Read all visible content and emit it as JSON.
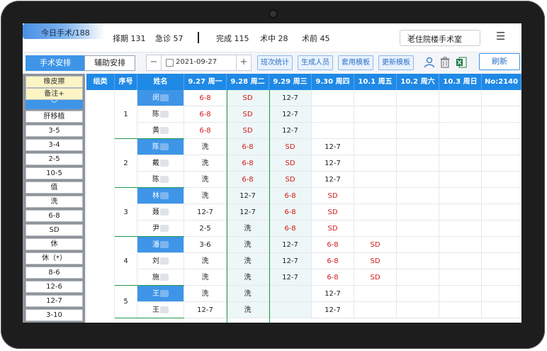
{
  "topbar": {
    "today_label": "今日手术/188",
    "stats": [
      {
        "label": "择期 131"
      },
      {
        "label": "急诊 57"
      },
      {
        "label": "完成 115"
      },
      {
        "label": "术中 28"
      },
      {
        "label": "术前 45"
      }
    ],
    "room_select": "老住院楼手术室",
    "menu_icon": "hamburger-menu-icon"
  },
  "toolbar": {
    "tab_active": "手术安排",
    "tab_inactive": "辅助安排",
    "date_value": "2021-09-27",
    "minus_label": "−",
    "plus_label": "+",
    "buttons": [
      "班次统计",
      "生成人员",
      "套用模板",
      "更新模板"
    ],
    "refresh_label": "刷新",
    "icons": [
      "user-icon",
      "trash-icon",
      "excel-icon"
    ]
  },
  "sidebar": {
    "items": [
      "橡皮擦",
      "备注+",
      "﹀",
      "肝移植",
      "3-5",
      "3-4",
      "2-5",
      "10-5",
      "值",
      "洗",
      "6-8",
      "SD",
      "休",
      "休（*）",
      "8-6",
      "12-6",
      "12-7",
      "3-10"
    ]
  },
  "grid": {
    "headers": [
      "组类",
      "序号",
      "姓名",
      "9.27 周一",
      "9.28 周二",
      "9.29 周三",
      "9.30 周四",
      "10.1 周五",
      "10.2 周六",
      "10.3 周日",
      "No:2140"
    ],
    "groups": [
      {
        "no": "1",
        "rows": [
          {
            "name": "闵",
            "hl": true,
            "days": [
              "6-8",
              "SD",
              "12-7",
              "",
              "",
              "",
              ""
            ]
          },
          {
            "name": "陈",
            "hl": false,
            "days": [
              "6-8",
              "SD",
              "12-7",
              "",
              "",
              "",
              ""
            ]
          },
          {
            "name": "黄",
            "hl": false,
            "days": [
              "6-8",
              "SD",
              "12-7",
              "",
              "",
              "",
              ""
            ]
          }
        ]
      },
      {
        "no": "2",
        "rows": [
          {
            "name": "陈",
            "hl": true,
            "days": [
              "洗",
              "6-8",
              "SD",
              "12-7",
              "",
              "",
              ""
            ]
          },
          {
            "name": "戴",
            "hl": false,
            "days": [
              "洗",
              "6-8",
              "SD",
              "12-7",
              "",
              "",
              ""
            ]
          },
          {
            "name": "陈",
            "hl": false,
            "days": [
              "洗",
              "6-8",
              "SD",
              "12-7",
              "",
              "",
              ""
            ]
          }
        ]
      },
      {
        "no": "3",
        "rows": [
          {
            "name": "林",
            "hl": true,
            "days": [
              "洗",
              "12-7",
              "6-8",
              "SD",
              "",
              "",
              ""
            ]
          },
          {
            "name": "聂",
            "hl": false,
            "days": [
              "12-7",
              "12-7",
              "6-8",
              "SD",
              "",
              "",
              ""
            ]
          },
          {
            "name": "尹",
            "hl": false,
            "days": [
              "2-5",
              "洗",
              "6-8",
              "SD",
              "",
              "",
              ""
            ]
          }
        ]
      },
      {
        "no": "4",
        "rows": [
          {
            "name": "潘",
            "hl": true,
            "days": [
              "3-6",
              "洗",
              "12-7",
              "6-8",
              "SD",
              "",
              ""
            ]
          },
          {
            "name": "刘",
            "hl": false,
            "days": [
              "洗",
              "洗",
              "12-7",
              "6-8",
              "SD",
              "",
              ""
            ]
          },
          {
            "name": "施",
            "hl": false,
            "days": [
              "洗",
              "洗",
              "12-7",
              "6-8",
              "SD",
              "",
              ""
            ]
          }
        ]
      },
      {
        "no": "5",
        "rows": [
          {
            "name": "王",
            "hl": true,
            "days": [
              "洗",
              "洗",
              "",
              "12-7",
              "",
              "",
              ""
            ]
          },
          {
            "name": "王",
            "hl": false,
            "days": [
              "12-7",
              "洗",
              "",
              "12-7",
              "",
              "",
              ""
            ]
          }
        ]
      }
    ],
    "red_values": [
      "6-8",
      "SD"
    ]
  },
  "colors": {
    "header_blue": "#1f89e6",
    "accent_red": "#d21a1a",
    "group_line_green": "#1f9a4e"
  }
}
